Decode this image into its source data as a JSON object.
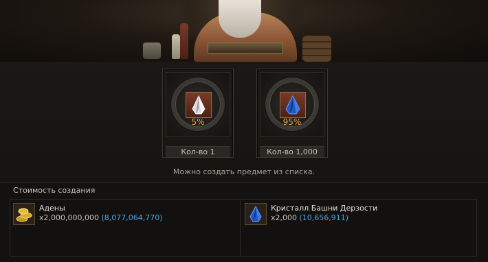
{
  "colors": {
    "accent_percent": "#f0a43a",
    "owned_amount": "#4aa4e6",
    "panel_border": "#3c3833"
  },
  "products": [
    {
      "icon": "silver-crystal-icon",
      "percent": "5%",
      "quantity": "Кол-во 1"
    },
    {
      "icon": "blue-crystal-icon",
      "percent": "95%",
      "quantity": "Кол-во 1,000"
    }
  ],
  "message": "Можно создать предмет из списка.",
  "cost": {
    "title": "Стоимость создания",
    "items": [
      {
        "icon": "adena-icon",
        "name": "Адены",
        "amount": "x2,000,000,000",
        "owned": "(8,077,064,770)"
      },
      {
        "icon": "blue-crystal-icon",
        "name": "Кристалл Башни Дерзости",
        "amount": "x2,000",
        "owned": "(10,656,911)"
      }
    ]
  }
}
